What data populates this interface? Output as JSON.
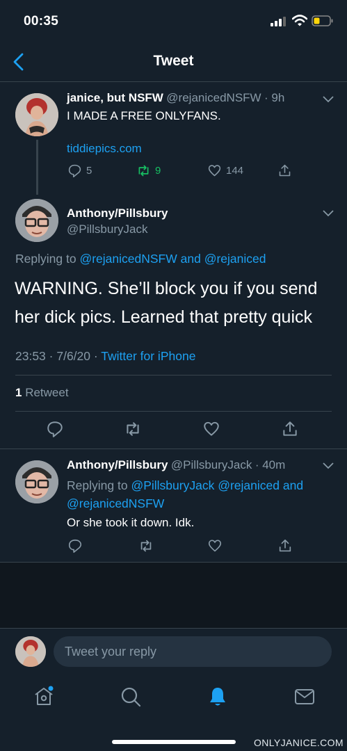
{
  "status": {
    "time": "00:35"
  },
  "header": {
    "title": "Tweet"
  },
  "parent_tweet": {
    "name": "janice, but NSFW",
    "handle": "@rejanicedNSFW",
    "time": "· 9h",
    "text": "I MADE A FREE ONLYFANS.",
    "link": "tiddiepics.com",
    "replies": "5",
    "retweets": "9",
    "likes": "144"
  },
  "main_tweet": {
    "name": "Anthony/Pillsbury",
    "handle": "@PillsburyJack",
    "replying_prefix": "Replying to",
    "replying_to_1": "@rejanicedNSFW",
    "replying_and": "and",
    "replying_to_2": "@rejaniced",
    "text_line1": "WARNING. She’ll block you if you send",
    "text_line2": "her dick pics. Learned that pretty quick",
    "timestamp": "23:53 · 7/6/20 ·",
    "source": "Twitter for iPhone",
    "retweet_count": "1",
    "retweet_label": "Retweet"
  },
  "reply_tweet": {
    "name": "Anthony/Pillsbury",
    "handle": "@PillsburyJack",
    "time": "· 40m",
    "replying_prefix": "Replying to",
    "replying_to_1": "@PillsburyJack",
    "replying_to_2": "@rejaniced",
    "replying_and": "and",
    "replying_to_3": "@rejanicedNSFW",
    "text": "Or she took it down. Idk."
  },
  "compose": {
    "placeholder": "Tweet your reply"
  },
  "watermark": "ONLYJANICE.COM",
  "colors": {
    "background": "#15202b",
    "accent": "#1da1f2",
    "retweet_green": "#17bf63",
    "muted": "#8899a6"
  }
}
